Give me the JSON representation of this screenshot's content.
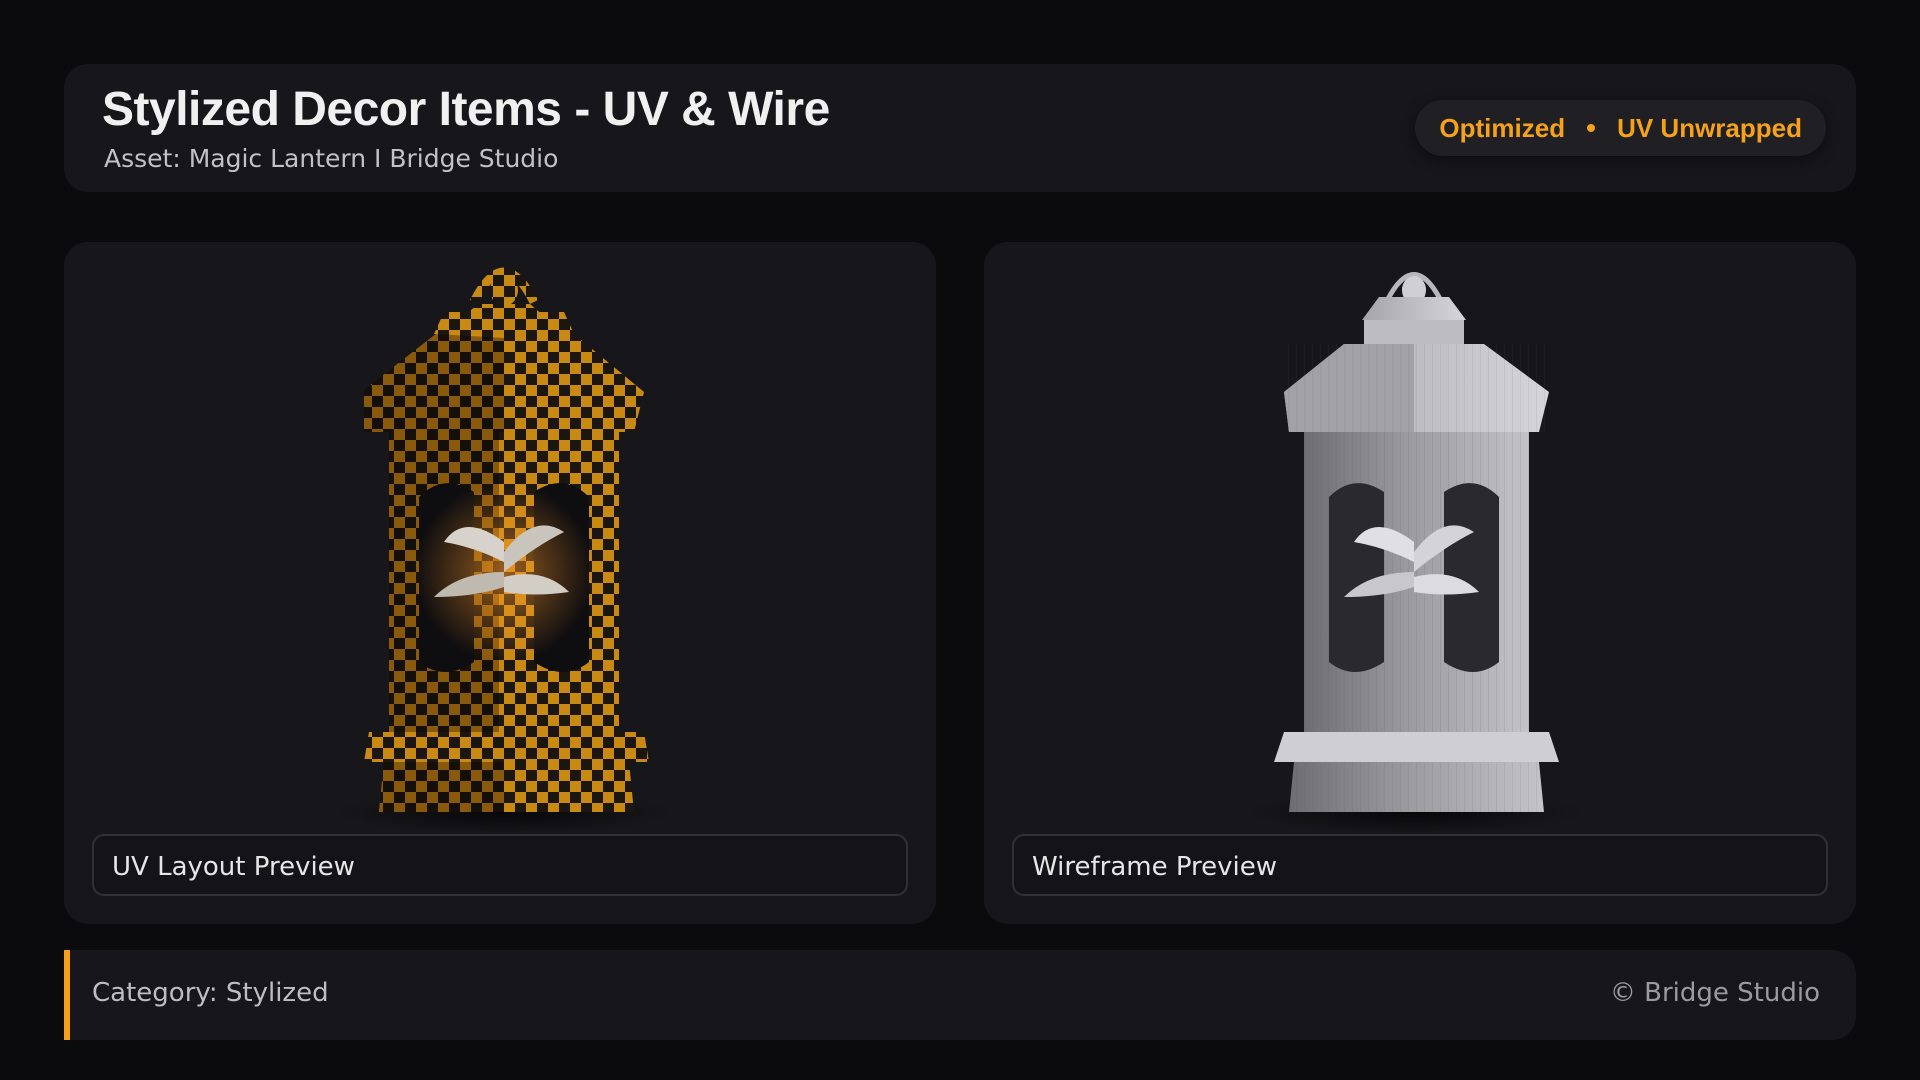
{
  "header": {
    "title": "Stylized Decor Items - UV & Wire",
    "subtitle": "Asset: Magic Lantern  I  Bridge Studio",
    "badges": [
      "Optimized",
      "UV Unwrapped"
    ]
  },
  "panels": [
    {
      "caption": "UV Layout Preview",
      "image": "lantern-uv-checker-render"
    },
    {
      "caption": "Wireframe Preview",
      "image": "lantern-wireframe-render"
    }
  ],
  "footer": {
    "category": "Category: Stylized",
    "copyright": "© Bridge Studio"
  },
  "colors": {
    "accent": "#f5a11a",
    "background": "#0b0b0d",
    "card": "#17171b"
  }
}
